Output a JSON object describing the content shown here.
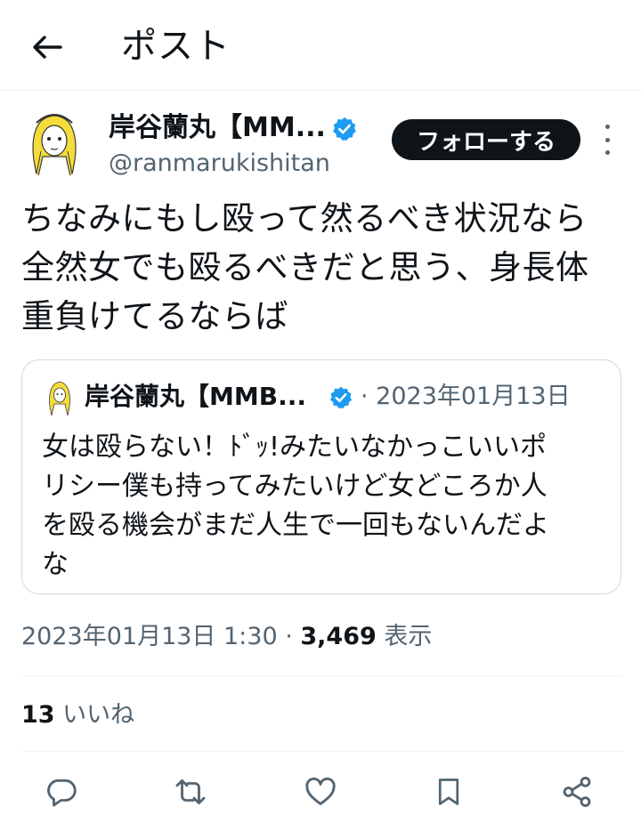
{
  "header": {
    "title": "ポスト",
    "back_icon": "arrow-left-icon"
  },
  "author": {
    "name": "岸谷蘭丸【MM...",
    "handle": "@ranmarukishitan",
    "verified": true,
    "verified_color": "#1d9bf0"
  },
  "follow_button": {
    "label": "フォローする"
  },
  "tweet": {
    "text_lines": [
      "ちなみにもし殴って然るべき状況なら",
      "全然女でも殴るべきだと思う、身長体",
      "重負けてるならば"
    ]
  },
  "quoted_tweet": {
    "author_name": "岸谷蘭丸【MMB...",
    "meta": "· 2023年01月13日",
    "text_lines": [
      "女は殴らない！ﾄﾞｯ!みたいなかっこいいポ",
      "リシー僕も持ってみたいけど女どころか人",
      "を殴る機会がまだ人生で一回もないんだよ",
      "な"
    ]
  },
  "meta": {
    "timestamp": "2023年01月13日 1:30 · ",
    "views_count": "3,469",
    "views_label": " 表示"
  },
  "likes": {
    "count": "13",
    "label": " いいね"
  },
  "actions": [
    "reply-icon",
    "retweet-icon",
    "like-icon",
    "bookmark-icon",
    "share-icon"
  ],
  "colors": {
    "text": "#0f1419",
    "secondary": "#536471",
    "border": "#cfd9de",
    "accent": "#1d9bf0"
  }
}
